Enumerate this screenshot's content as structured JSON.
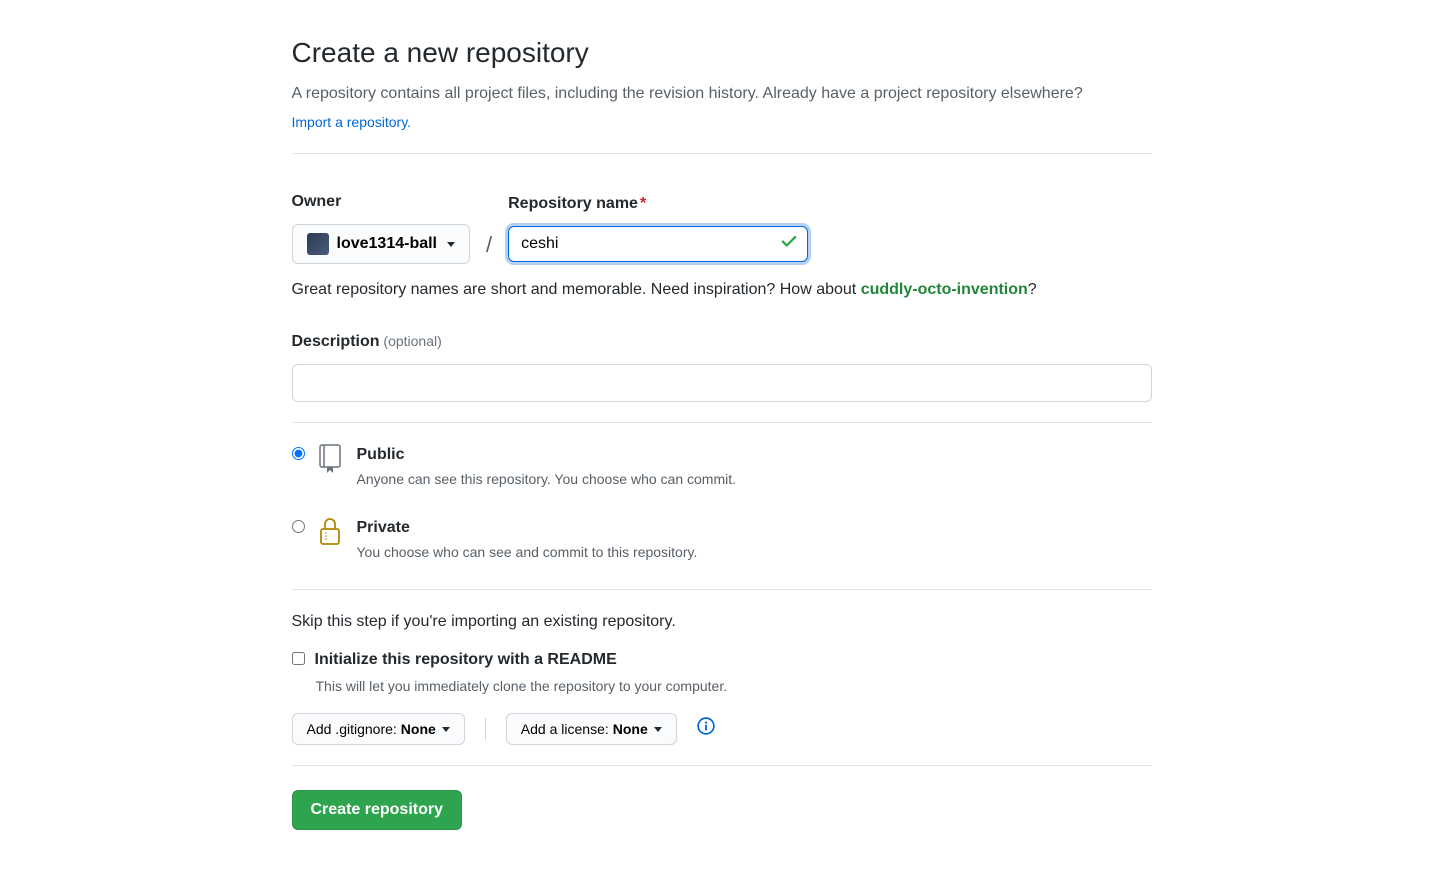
{
  "header": {
    "title": "Create a new repository",
    "subhead_a": "A repository contains all project files, including the revision history. Already have a project repository elsewhere? ",
    "import_link": "Import a repository."
  },
  "form": {
    "owner_label": "Owner",
    "owner_name": "love1314-ball",
    "repo_label": "Repository name",
    "repo_value": "ceshi",
    "hint_prefix": "Great repository names are short and memorable. Need inspiration? How about ",
    "suggestion": "cuddly-octo-invention",
    "hint_suffix": "?",
    "desc_label": "Description",
    "optional_text": "(optional)",
    "desc_value": ""
  },
  "visibility": {
    "public": {
      "title": "Public",
      "desc": "Anyone can see this repository. You choose who can commit."
    },
    "private": {
      "title": "Private",
      "desc": "You choose who can see and commit to this repository."
    }
  },
  "init": {
    "skip_text": "Skip this step if you're importing an existing repository.",
    "readme_label": "Initialize this repository with a README",
    "readme_desc": "This will let you immediately clone the repository to your computer.",
    "gitignore_prefix": "Add .gitignore: ",
    "gitignore_value": "None",
    "license_prefix": "Add a license: ",
    "license_value": "None"
  },
  "submit": {
    "button": "Create repository"
  }
}
